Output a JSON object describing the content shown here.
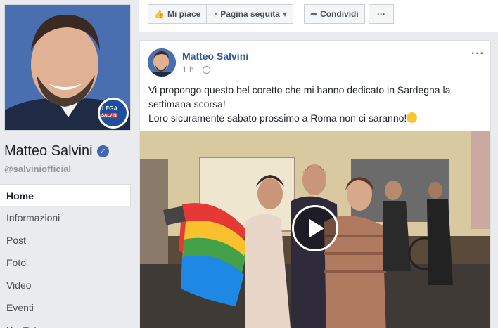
{
  "page": {
    "name": "Matteo Salvini",
    "handle": "@salviniofficial",
    "verified_icon": "verified-badge-icon",
    "profile_logo_text": "LEGA",
    "profile_logo_subtext": "SALVINI"
  },
  "left_nav": {
    "items": [
      {
        "label": "Home",
        "active": true
      },
      {
        "label": "Informazioni"
      },
      {
        "label": "Post"
      },
      {
        "label": "Foto"
      },
      {
        "label": "Video"
      },
      {
        "label": "Eventi"
      },
      {
        "label": "YouTube"
      }
    ]
  },
  "action_bar": {
    "like_label": "Mi piace",
    "follow_label": "Pagina seguita",
    "share_label": "Condividi",
    "more_label": "···"
  },
  "post": {
    "author": "Matteo Salvini",
    "time": "1 h",
    "separator": "·",
    "more_label": "···",
    "text_line1": "Vi propongo questo bel coretto che mi hanno dedicato in Sardegna la settimana scorsa!",
    "text_line2": "Loro sicuramente sabato prossimo a Roma non ci saranno!"
  },
  "colors": {
    "link": "#365899",
    "brand": "#3b5998",
    "verified": "#4267b2"
  }
}
